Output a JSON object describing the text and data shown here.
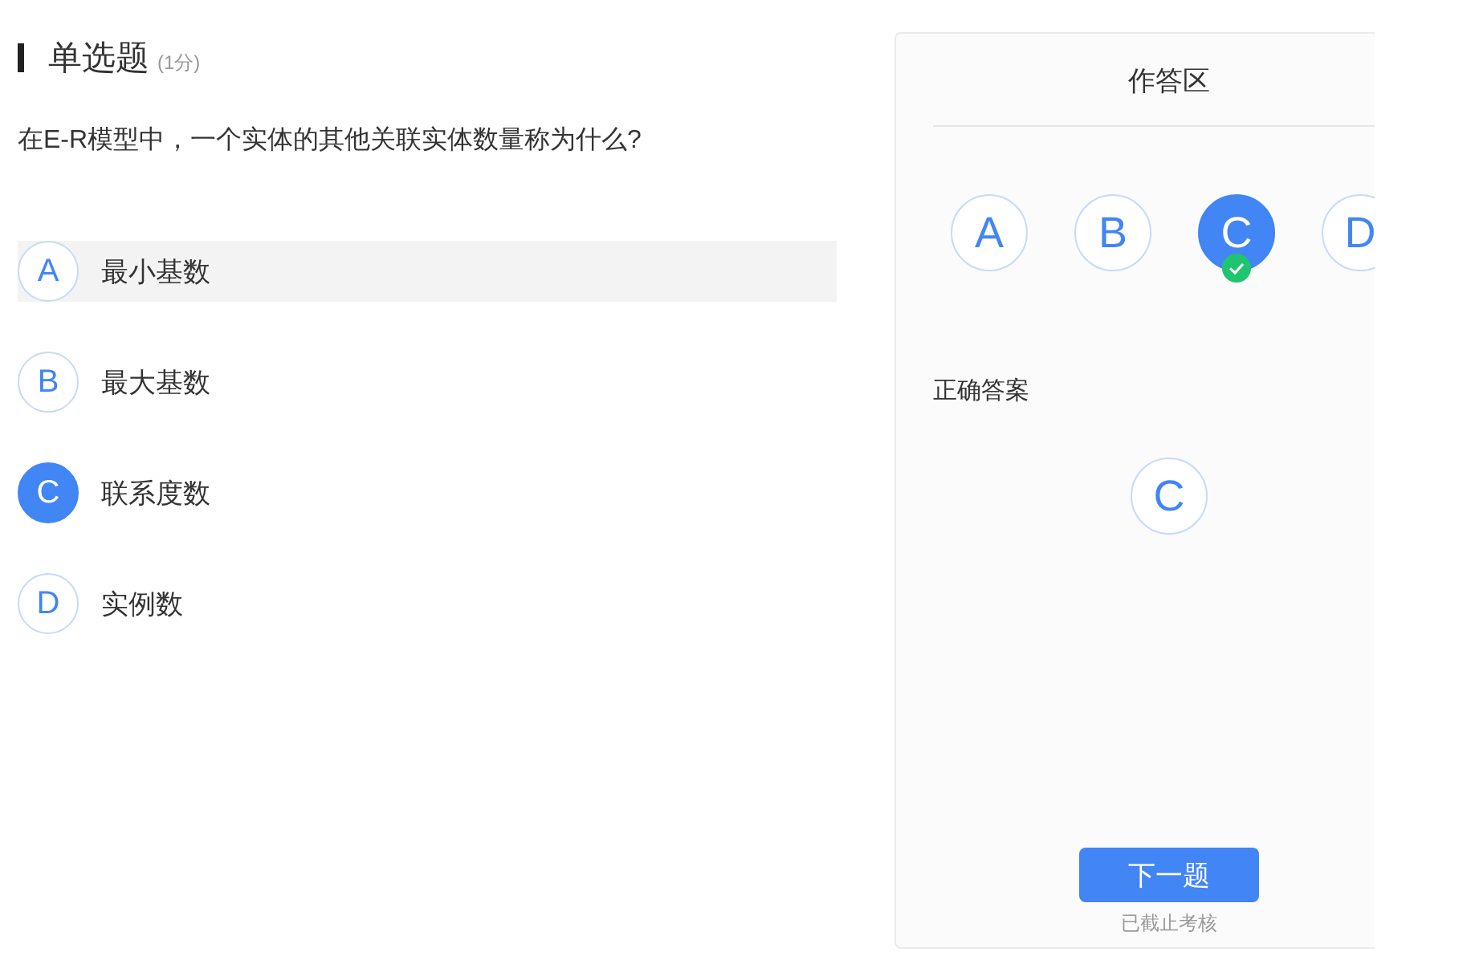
{
  "question": {
    "type": "单选题",
    "score": "(1分)",
    "text": "在E-R模型中，一个实体的其他关联实体数量称为什么?",
    "options": [
      {
        "letter": "A",
        "text": "最小基数",
        "selected": false,
        "highlighted": true
      },
      {
        "letter": "B",
        "text": "最大基数",
        "selected": false,
        "highlighted": false
      },
      {
        "letter": "C",
        "text": "联系度数",
        "selected": true,
        "highlighted": false
      },
      {
        "letter": "D",
        "text": "实例数",
        "selected": false,
        "highlighted": false
      }
    ]
  },
  "answer_panel": {
    "title": "作答区",
    "choices": [
      {
        "letter": "A",
        "selected": false,
        "correct": false
      },
      {
        "letter": "B",
        "selected": false,
        "correct": false
      },
      {
        "letter": "C",
        "selected": true,
        "correct": true
      },
      {
        "letter": "D",
        "selected": false,
        "correct": false
      }
    ],
    "correct_label": "正确答案",
    "correct_answer": "C",
    "next_button": "下一题",
    "status": "已截止考核"
  }
}
